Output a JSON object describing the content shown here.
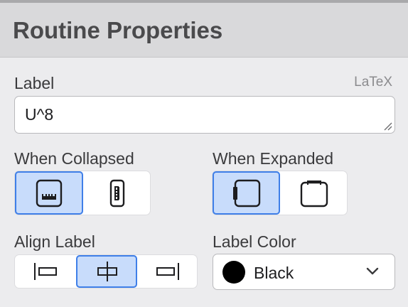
{
  "panel": {
    "title": "Routine Properties"
  },
  "label_section": {
    "label": "Label",
    "latex_badge": "LaTeX",
    "value": "U^8"
  },
  "when_collapsed": {
    "label": "When Collapsed",
    "options": [
      {
        "icon": "collapsed-label-inside-icon",
        "selected": true
      },
      {
        "icon": "collapsed-label-side-icon",
        "selected": false
      }
    ]
  },
  "when_expanded": {
    "label": "When Expanded",
    "options": [
      {
        "icon": "expanded-label-left-icon",
        "selected": true
      },
      {
        "icon": "expanded-label-top-icon",
        "selected": false
      }
    ]
  },
  "align_label": {
    "label": "Align Label",
    "options": [
      {
        "icon": "align-left-icon",
        "selected": false
      },
      {
        "icon": "align-center-icon",
        "selected": true
      },
      {
        "icon": "align-right-icon",
        "selected": false
      }
    ]
  },
  "label_color": {
    "label": "Label Color",
    "value": "Black",
    "swatch": "#000000"
  },
  "colors": {
    "accent": "#3f7fe8",
    "selected_bg": "#c8dcfb",
    "header_bg": "#d9d9db",
    "panel_bg": "#ececee"
  }
}
